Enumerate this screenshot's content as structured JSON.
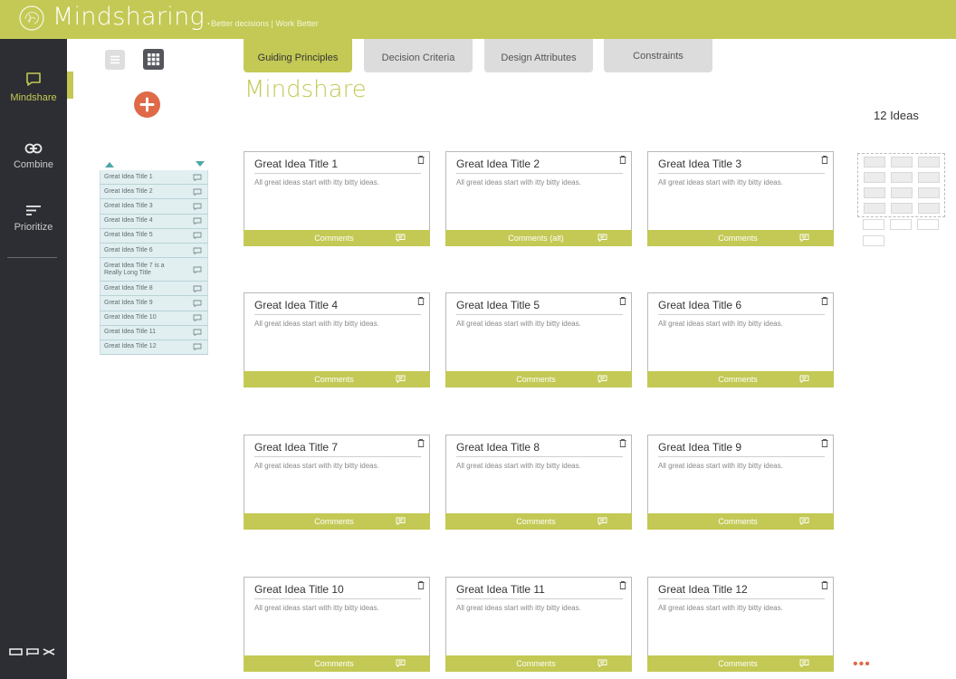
{
  "app": {
    "title": "Mindsharing.",
    "tagline": "Better decisions | Work Better"
  },
  "sidebar": {
    "items": [
      {
        "label": "Mindshare",
        "icon": "chat-bubble-icon",
        "active": true
      },
      {
        "label": "Combine",
        "icon": "link-icon",
        "active": false
      },
      {
        "label": "Prioritize",
        "icon": "sort-lines-icon",
        "active": false
      }
    ],
    "footer_logo": "opx"
  },
  "toolbar": {
    "list_view_icon": "list-icon",
    "grid_view_icon": "grid-icon",
    "add_icon": "plus-icon"
  },
  "tabs": [
    {
      "label": "Guiding Principles",
      "active": true
    },
    {
      "label": "Decision Criteria",
      "active": false
    },
    {
      "label": "Design Attributes",
      "active": false
    },
    {
      "label": "Constraints",
      "active": false
    }
  ],
  "main": {
    "heading": "Mindshare",
    "ideas_count": "12 Ideas"
  },
  "idea_list": [
    "Great Idea Title 1",
    "Great Idea Title 2",
    "Great Idea Title 3",
    "Great Idea Title 4",
    "Great Idea Title 5",
    "Great Idea Title 6",
    "Great Idea Title 7 is a Really Long Title",
    "Great Idea Title 8",
    "Great Idea Title 9",
    "Great Idea Title 10",
    "Great Idea Title 11",
    "Great Idea Title 12"
  ],
  "cards": [
    {
      "title": "Great Idea Title 1",
      "desc": "All great ideas start with itty bitty ideas.",
      "footer": "Comments"
    },
    {
      "title": "Great Idea Title 2",
      "desc": "All great ideas start with itty bitty ideas.",
      "footer": "Comments (alt)"
    },
    {
      "title": "Great Idea Title 3",
      "desc": "All great ideas start with itty bitty ideas.",
      "footer": "Comments"
    },
    {
      "title": "Great Idea Title 4",
      "desc": "All great ideas start with itty bitty ideas.",
      "footer": "Comments"
    },
    {
      "title": "Great Idea Title 5",
      "desc": "All great ideas start with itty bitty ideas.",
      "footer": "Comments"
    },
    {
      "title": "Great Idea Title 6",
      "desc": "All great ideas start with itty bitty ideas.",
      "footer": "Comments"
    },
    {
      "title": "Great Idea Title 7",
      "desc": "All great ideas start with itty bitty ideas.",
      "footer": "Comments"
    },
    {
      "title": "Great Idea Title 8",
      "desc": "All great ideas start with itty bitty ideas.",
      "footer": "Comments"
    },
    {
      "title": "Great Idea Title 9",
      "desc": "All great ideas start with itty bitty ideas.",
      "footer": "Comments"
    },
    {
      "title": "Great Idea Title 10",
      "desc": "All great ideas start with itty bitty ideas.",
      "footer": "Comments"
    },
    {
      "title": "Great Idea Title 11",
      "desc": "All great ideas start with itty bitty ideas.",
      "footer": "Comments"
    },
    {
      "title": "Great Idea Title 12",
      "desc": "All great ideas start with itty bitty ideas.",
      "footer": "Comments"
    }
  ],
  "colors": {
    "accent": "#c3c954",
    "sidebar": "#2d2e33",
    "add_button": "#de6a47",
    "list_bg": "#e1eff1",
    "sort_arrow": "#4fa7a7"
  }
}
